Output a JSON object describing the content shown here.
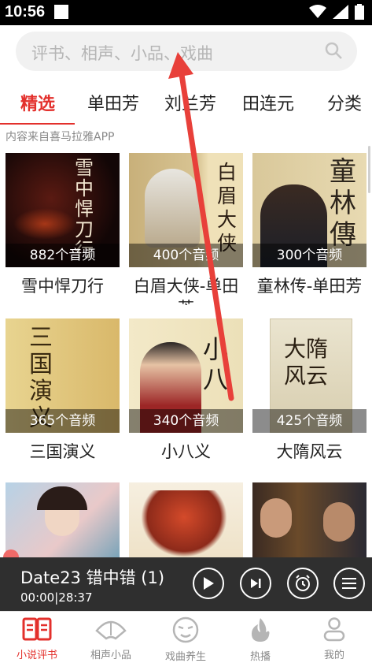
{
  "status_bar": {
    "time": "10:56"
  },
  "search": {
    "placeholder": "评书、相声、小品、戏曲"
  },
  "tabs": [
    {
      "label": "精选"
    },
    {
      "label": "单田芳"
    },
    {
      "label": "刘兰芳"
    },
    {
      "label": "田连元"
    },
    {
      "label": "分类"
    }
  ],
  "source_note": "内容来自喜马拉雅APP",
  "albums": [
    {
      "title": "雪中悍刀行",
      "count": "882个音频",
      "cover_text": "雪中悍刀行"
    },
    {
      "title": "白眉大侠-单田芳",
      "count": "400个音频",
      "cover_text": "白眉大侠"
    },
    {
      "title": "童林传-单田芳",
      "count": "300个音频",
      "cover_text": "童林傳"
    },
    {
      "title": "三国演义",
      "count": "365个音频",
      "cover_text": "三国演义"
    },
    {
      "title": "小八义",
      "count": "340个音频",
      "cover_text": "小八"
    },
    {
      "title": "大隋风云",
      "count": "425个音频",
      "cover_text": "大隋风云"
    },
    {
      "title": "",
      "count": "",
      "cover_text": ""
    },
    {
      "title": "",
      "count": "",
      "cover_text": ""
    },
    {
      "title": "",
      "count": "",
      "cover_text": ""
    }
  ],
  "player": {
    "title": "Date23 错中错 (1)",
    "time": "00:00|28:37",
    "progress": 0.0
  },
  "bottom_nav": [
    {
      "label": "小说评书",
      "active": true
    },
    {
      "label": "相声小品",
      "active": false
    },
    {
      "label": "戏曲养生",
      "active": false
    },
    {
      "label": "热播",
      "active": false
    },
    {
      "label": "我的",
      "active": false
    }
  ],
  "colors": {
    "accent": "#e3302c",
    "player_bg": "#2f2f2f"
  }
}
